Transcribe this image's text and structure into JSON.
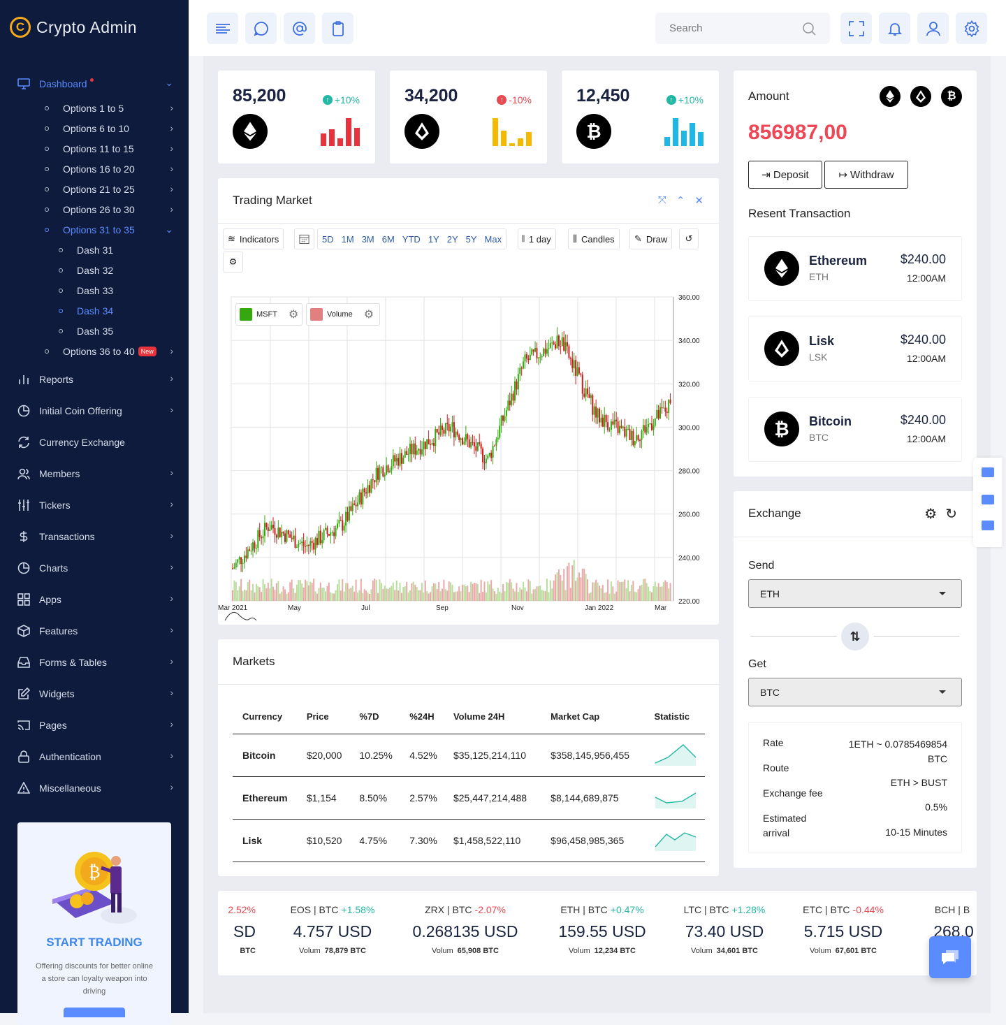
{
  "brand": {
    "name": "Crypto Admin"
  },
  "sidebar": {
    "dashboard_label": "Dashboard",
    "options": [
      "Options 1 to 5",
      "Options 6 to 10",
      "Options 11 to 15",
      "Options 16 to 20",
      "Options 21 to 25",
      "Options 26 to 30",
      "Options 31 to 35"
    ],
    "dashes": [
      "Dash 31",
      "Dash 32",
      "Dash 33",
      "Dash 34",
      "Dash 35"
    ],
    "options_last": "Options 36 to 40",
    "new_badge": "New",
    "items": [
      "Reports",
      "Initial Coin Offering",
      "Currency Exchange",
      "Members",
      "Tickers",
      "Transactions",
      "Charts",
      "Apps",
      "Features",
      "Forms & Tables",
      "Widgets",
      "Pages",
      "Authentication",
      "Miscellaneous"
    ]
  },
  "promo": {
    "title": "START TRADING",
    "desc": "Offering discounts for better online a store can loyalty weapon into driving"
  },
  "topbar": {
    "search_placeholder": "Search"
  },
  "stats": [
    {
      "value": "85,200",
      "change": "+10%",
      "coin": "ETH",
      "color": "#e8323c",
      "bars": [
        0.4,
        0.55,
        0.25,
        0.9,
        0.6
      ]
    },
    {
      "value": "34,200",
      "change": "-10%",
      "coin": "LSK",
      "color": "#f5b900",
      "bars": [
        0.9,
        0.5,
        0.1,
        0.25,
        0.45
      ]
    },
    {
      "value": "12,450",
      "change": "+10%",
      "coin": "BTC",
      "color": "#1fb6e8",
      "bars": [
        0.3,
        0.9,
        0.5,
        0.75,
        0.45
      ]
    }
  ],
  "trading": {
    "title": "Trading Market",
    "indicators": "Indicators",
    "ranges": [
      "5D",
      "1M",
      "3M",
      "6M",
      "YTD",
      "1Y",
      "2Y",
      "5Y",
      "Max"
    ],
    "interval": "1 day",
    "style": "Candles",
    "draw": "Draw",
    "legend_msft": "MSFT",
    "legend_volume": "Volume"
  },
  "chart_data": {
    "type": "line",
    "title": "Trading Market",
    "series": [
      {
        "name": "MSFT",
        "x": [
          "Mar 2021",
          "Apr 2021",
          "May 2021",
          "Jun 2021",
          "Jul 2021",
          "Aug 2021",
          "Sep 2021",
          "Oct 2021",
          "Nov 2021",
          "Dec 2021",
          "Jan 2022",
          "Feb 2022",
          "Mar 2022"
        ],
        "values": [
          235,
          255,
          245,
          255,
          280,
          290,
          300,
          285,
          330,
          340,
          305,
          295,
          310
        ]
      }
    ],
    "x_ticks": [
      "Mar 2021",
      "May",
      "Jul",
      "Sep",
      "Nov",
      "Jan 2022",
      "Mar"
    ],
    "y_ticks": [
      "360.00",
      "340.00",
      "320.00",
      "300.00",
      "280.00",
      "260.00",
      "240.00",
      "220.00"
    ],
    "ylim": [
      220,
      360
    ],
    "grid": true
  },
  "markets": {
    "title": "Markets",
    "headers": [
      "Currency",
      "Price",
      "%7D",
      "%24H",
      "Volume 24H",
      "Market Cap",
      "Statistic"
    ],
    "rows": [
      [
        "Bitcoin",
        "$20,000",
        "10.25%",
        "4.52%",
        "$35,125,214,110",
        "$358,145,956,455"
      ],
      [
        "Ethereum",
        "$1,154",
        "8.50%",
        "2.57%",
        "$25,447,214,488",
        "$8,144,689,875"
      ],
      [
        "Lisk",
        "$10,520",
        "4.75%",
        "7.30%",
        "$1,458,522,110",
        "$96,458,985,365"
      ]
    ]
  },
  "amount": {
    "title": "Amount",
    "value": "856987,00",
    "deposit": "Deposit",
    "withdraw": "Withdraw",
    "recent_title": "Resent Transaction",
    "transactions": [
      {
        "name": "Ethereum",
        "sym": "ETH",
        "amount": "$240.00",
        "time": "12:00AM"
      },
      {
        "name": "Lisk",
        "sym": "LSK",
        "amount": "$240.00",
        "time": "12:00AM"
      },
      {
        "name": "Bitcoin",
        "sym": "BTC",
        "amount": "$240.00",
        "time": "12:00AM"
      }
    ]
  },
  "exchange": {
    "title": "Exchange",
    "send_label": "Send",
    "send_value": "ETH",
    "get_label": "Get",
    "get_value": "BTC",
    "rate_label": "Rate",
    "rate_value": "1ETH ~ 0.0785469854 BTC",
    "route_label": "Route",
    "route_value": "ETH > BUST",
    "fee_label": "Exchange fee",
    "fee_value": "0.5%",
    "arrival_label": "Estimated arrival",
    "arrival_value": "10-15 Minutes"
  },
  "tickers": [
    {
      "pair": "",
      "change": "2.52%",
      "dir": "dn",
      "value": "SD",
      "vol_label": "",
      "vol": "BTC"
    },
    {
      "pair": "EOS | BTC",
      "change": "+1.58%",
      "dir": "up",
      "value": "4.757 USD",
      "vol_label": "Volum",
      "vol": "78,879 BTC"
    },
    {
      "pair": "ZRX | BTC",
      "change": "-2.07%",
      "dir": "dn",
      "value": "0.268135 USD",
      "vol_label": "Volum",
      "vol": "65,908 BTC"
    },
    {
      "pair": "ETH | BTC",
      "change": "+0.47%",
      "dir": "up",
      "value": "159.55 USD",
      "vol_label": "Volum",
      "vol": "12,234 BTC"
    },
    {
      "pair": "LTC | BTC",
      "change": "+1.28%",
      "dir": "up",
      "value": "73.40 USD",
      "vol_label": "Volum",
      "vol": "34,601 BTC"
    },
    {
      "pair": "ETC | BTC",
      "change": "-0.44%",
      "dir": "dn",
      "value": "5.715 USD",
      "vol_label": "Volum",
      "vol": "67,601 BTC"
    },
    {
      "pair": "BCH | B",
      "change": "",
      "dir": "up",
      "value": "268.0",
      "vol_label": "",
      "vol": ""
    }
  ]
}
